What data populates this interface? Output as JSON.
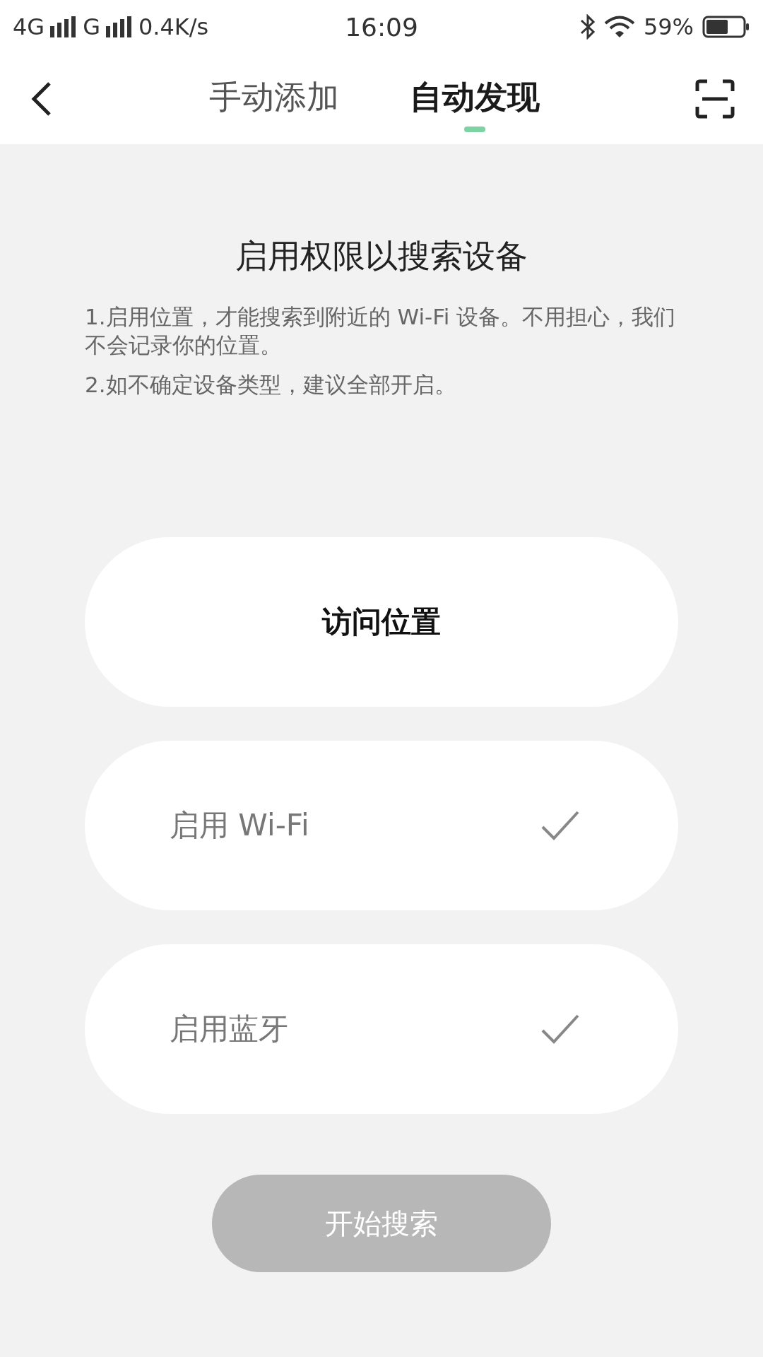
{
  "status_bar": {
    "network_1": "4G",
    "network_2": "G",
    "speed": "0.4K/s",
    "time": "16:09",
    "battery": "59%"
  },
  "tabs": [
    {
      "label": "手动添加",
      "selected": false
    },
    {
      "label": "自动发现",
      "selected": true
    }
  ],
  "title": "启用权限以搜索设备",
  "notes": [
    "1.启用位置，才能搜索到附近的 Wi-Fi 设备。不用担心，我们不会记录你的位置。",
    "2.如不确定设备类型，建议全部开启。"
  ],
  "permissions": [
    {
      "label": "访问位置",
      "granted": false
    },
    {
      "label": "启用 Wi-Fi",
      "granted": true
    },
    {
      "label": "启用蓝牙",
      "granted": true
    }
  ],
  "start_button": {
    "label": "开始搜索",
    "disabled": true
  }
}
